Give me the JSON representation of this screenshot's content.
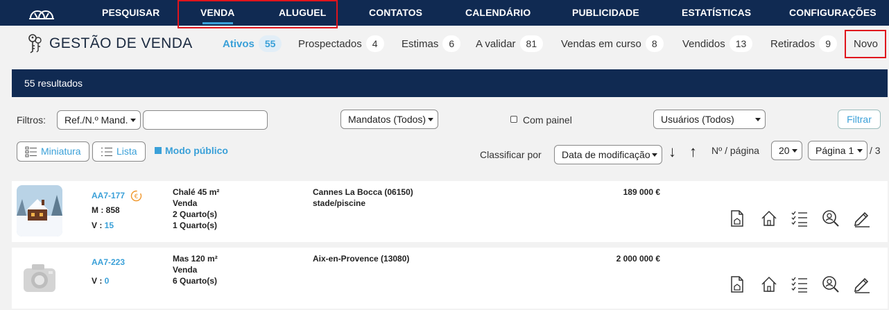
{
  "nav": {
    "items": [
      "PESQUISAR",
      "VENDA",
      "ALUGUEL",
      "CONTATOS",
      "CALENDÁRIO",
      "PUBLICIDADE",
      "ESTATÍSTICAS",
      "CONFIGURAÇÕES"
    ],
    "active": "VENDA"
  },
  "page": {
    "title": "GESTÃO DE VENDA"
  },
  "tabs": [
    {
      "label": "Ativos",
      "count": "55",
      "active": true
    },
    {
      "label": "Prospectados",
      "count": "4"
    },
    {
      "label": "Estimas",
      "count": "6"
    },
    {
      "label": "A validar",
      "count": "81"
    },
    {
      "label": "Vendas em curso",
      "count": "8"
    },
    {
      "label": "Vendidos",
      "count": "13"
    },
    {
      "label": "Retirados",
      "count": "9"
    },
    {
      "label": "Novo"
    }
  ],
  "results": {
    "text": "55 resultados"
  },
  "filters": {
    "label": "Filtros:",
    "ref_select": "Ref./N.º Mand.",
    "ref_input_value": "",
    "mandates_select": "Mandatos (Todos)",
    "panel_checkbox": "Com painel",
    "users_select": "Usuários (Todos)",
    "filter_button": "Filtrar"
  },
  "view": {
    "thumbnail_button": "Miniatura",
    "list_button": "Lista",
    "public_mode": "Modo público",
    "sort_label": "Classificar por",
    "sort_select": "Data de modificação",
    "per_page_label": "Nº / página",
    "per_page_select": "20",
    "page_select": "Página 1",
    "page_total": "/ 3"
  },
  "listings": [
    {
      "ref": "AA7-177",
      "mandate": "M : 858",
      "views_label": "V : ",
      "views": "15",
      "type": "Chalé 45 m²",
      "transaction": "Venda",
      "rooms": [
        "2 Quarto(s)",
        "1 Quarto(s)"
      ],
      "location": "Cannes La Bocca (06150)",
      "extra": "stade/piscine",
      "price": "189 000 €",
      "image": "snowy-chalet-photo"
    },
    {
      "ref": "AA7-223",
      "views_label": "V : ",
      "views": "0",
      "type": "Mas 120 m²",
      "transaction": "Venda",
      "rooms": [
        "6 Quarto(s)"
      ],
      "location": "Aix-en-Provence (13080)",
      "price": "2 000 000 €",
      "image": "camera-placeholder"
    }
  ],
  "colors": {
    "navbar": "#102a52",
    "accent": "#3aa0d8",
    "highlight": "#e0141c"
  }
}
